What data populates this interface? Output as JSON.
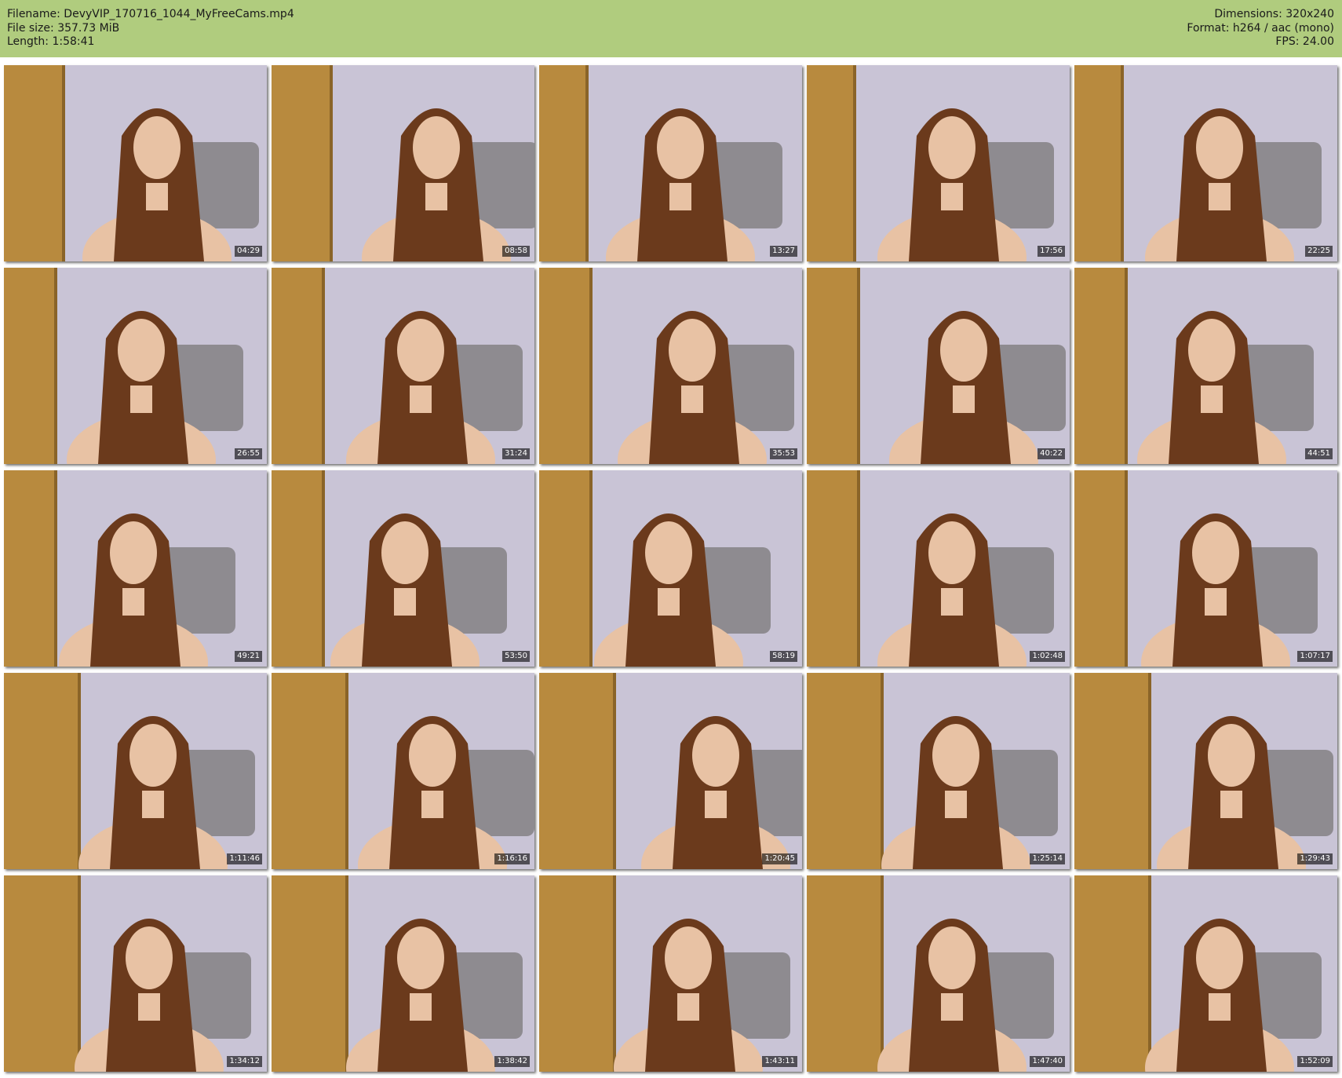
{
  "info": {
    "filename": "Filename: DevyVIP_170716_1044_MyFreeCams.mp4",
    "filesize": "File size: 357.73 MiB",
    "length": "Length: 1:58:41",
    "dimensions": "Dimensions: 320x240",
    "format": "Format: h264 / aac (mono)",
    "fps": "FPS: 24.00"
  },
  "colors": {
    "header_bg": "#b0cc7e",
    "wall": "#c9c4d6",
    "door": "#b88a3e",
    "chair": "#8e8b90",
    "hair": "#6b3a1c",
    "skin": "#e8c2a4"
  },
  "thumbnails": [
    {
      "timestamp": "04:29"
    },
    {
      "timestamp": "08:58"
    },
    {
      "timestamp": "13:27"
    },
    {
      "timestamp": "17:56"
    },
    {
      "timestamp": "22:25"
    },
    {
      "timestamp": "26:55"
    },
    {
      "timestamp": "31:24"
    },
    {
      "timestamp": "35:53"
    },
    {
      "timestamp": "40:22"
    },
    {
      "timestamp": "44:51"
    },
    {
      "timestamp": "49:21"
    },
    {
      "timestamp": "53:50"
    },
    {
      "timestamp": "58:19"
    },
    {
      "timestamp": "1:02:48"
    },
    {
      "timestamp": "1:07:17"
    },
    {
      "timestamp": "1:11:46"
    },
    {
      "timestamp": "1:16:16"
    },
    {
      "timestamp": "1:20:45"
    },
    {
      "timestamp": "1:25:14"
    },
    {
      "timestamp": "1:29:43"
    },
    {
      "timestamp": "1:34:12"
    },
    {
      "timestamp": "1:38:42"
    },
    {
      "timestamp": "1:43:11"
    },
    {
      "timestamp": "1:47:40"
    },
    {
      "timestamp": "1:52:09"
    }
  ]
}
